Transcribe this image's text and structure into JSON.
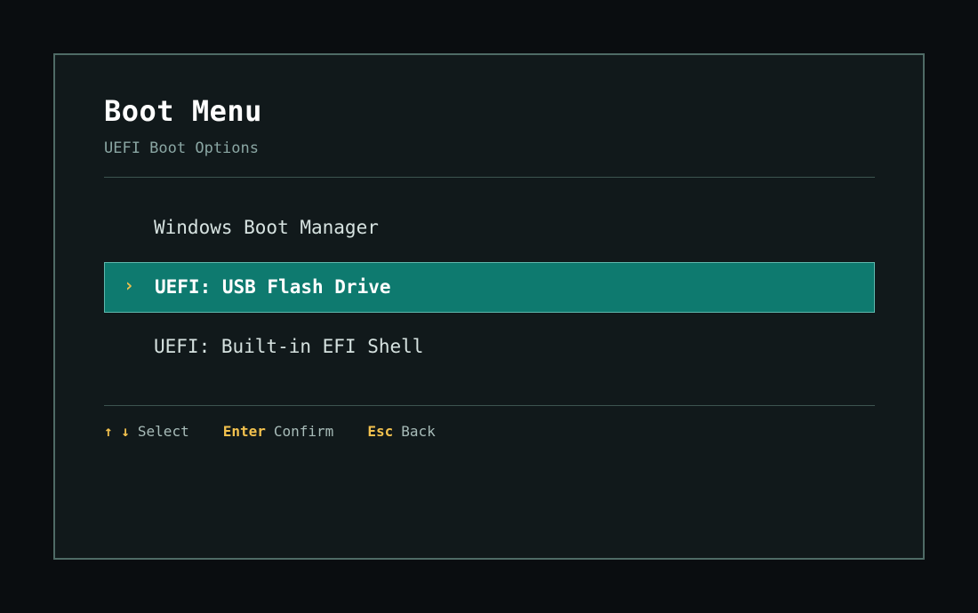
{
  "header": {
    "title": "Boot Menu",
    "subtitle": "UEFI Boot Options"
  },
  "menu": {
    "items": [
      {
        "label": "Windows Boot Manager",
        "selected": false
      },
      {
        "label": "UEFI: USB Flash Drive",
        "selected": true
      },
      {
        "label": "UEFI: Built-in EFI Shell",
        "selected": false
      }
    ],
    "selection_marker": "›"
  },
  "hints": {
    "navigate_keys": "↑ ↓",
    "navigate_label": "Select",
    "confirm_key": "Enter",
    "confirm_label": "Confirm",
    "back_key": "Esc",
    "back_label": "Back"
  },
  "colors": {
    "background": "#0a0d10",
    "panel": "#11191b",
    "selection": "#0e7a6f",
    "key_accent": "#f2c14e"
  }
}
